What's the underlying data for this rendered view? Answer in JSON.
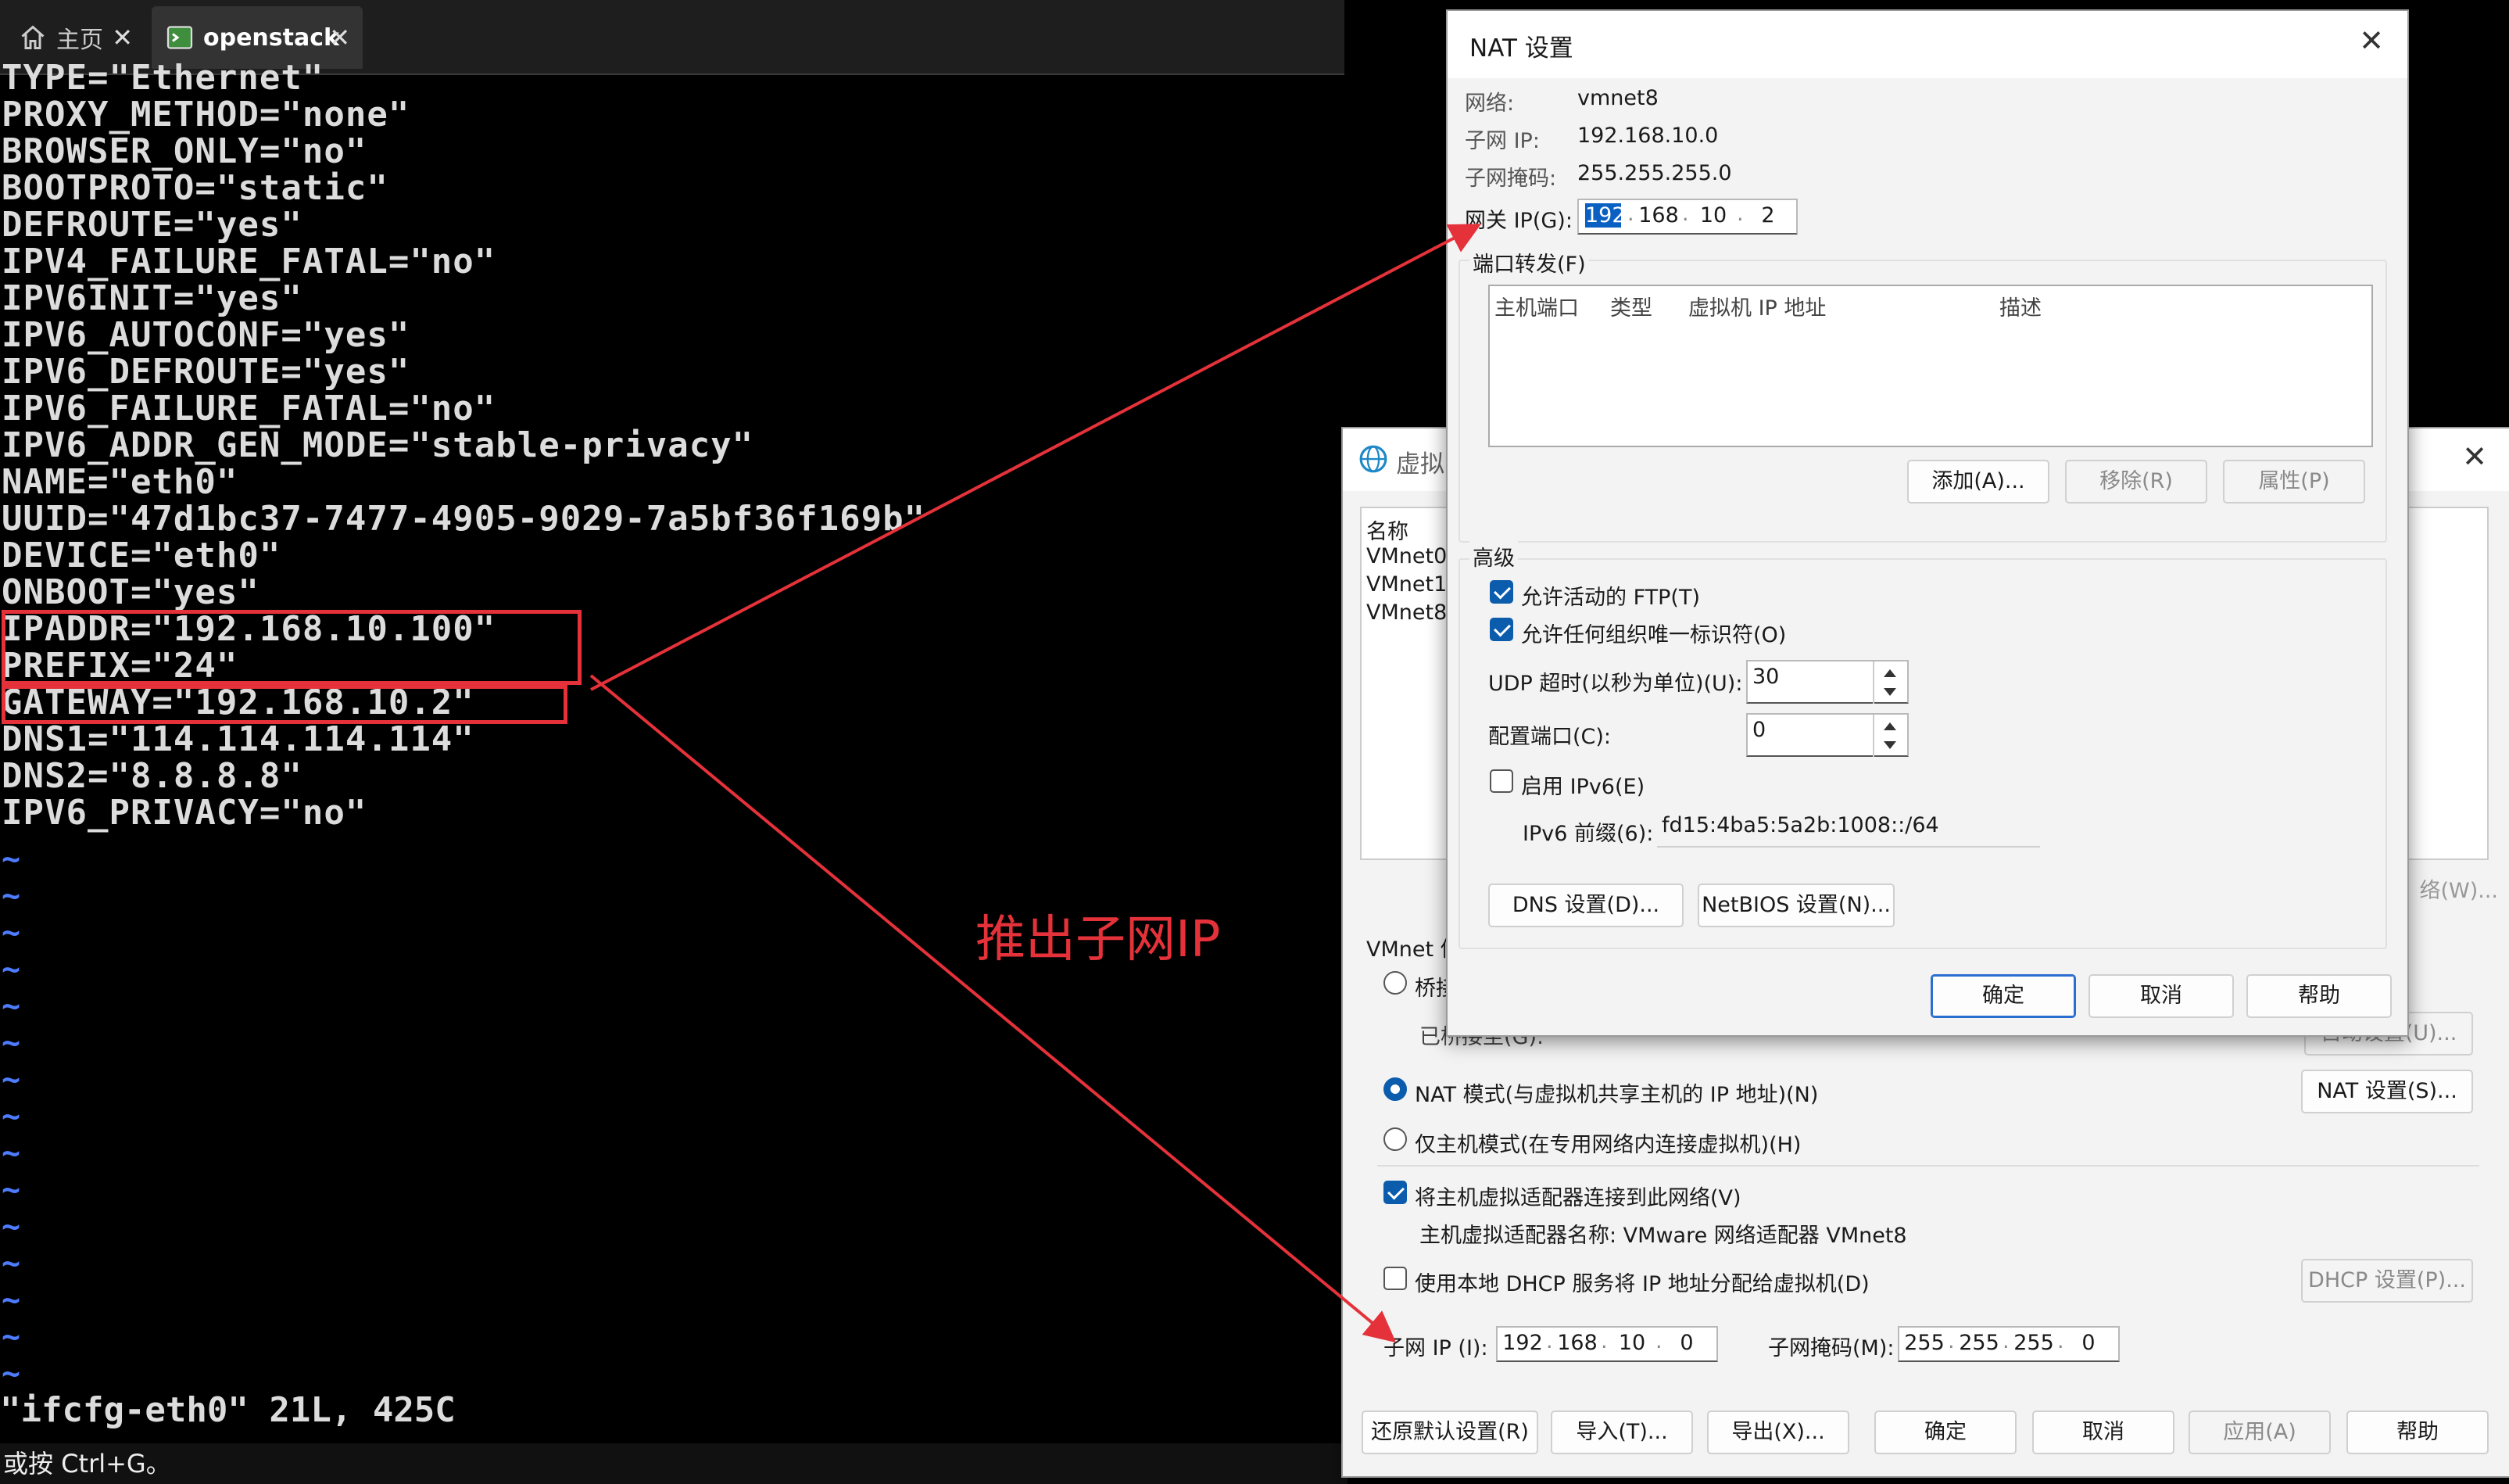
{
  "tabs": [
    {
      "label": "主页",
      "icon": "home-icon"
    },
    {
      "label": "openstack",
      "icon": "terminal-icon"
    }
  ],
  "terminal": {
    "lines": [
      "TYPE=\"Ethernet\"",
      "PROXY_METHOD=\"none\"",
      "BROWSER_ONLY=\"no\"",
      "BOOTPROTO=\"static\"",
      "DEFROUTE=\"yes\"",
      "IPV4_FAILURE_FATAL=\"no\"",
      "IPV6INIT=\"yes\"",
      "IPV6_AUTOCONF=\"yes\"",
      "IPV6_DEFROUTE=\"yes\"",
      "IPV6_FAILURE_FATAL=\"no\"",
      "IPV6_ADDR_GEN_MODE=\"stable-privacy\"",
      "NAME=\"eth0\"",
      "UUID=\"47d1bc37-7477-4905-9029-7a5bf36f169b\"",
      "DEVICE=\"eth0\"",
      "ONBOOT=\"yes\"",
      "IPADDR=\"192.168.10.100\"",
      "PREFIX=\"24\"",
      "GATEWAY=\"192.168.10.2\"",
      "DNS1=\"114.114.114.114\"",
      "DNS2=\"8.8.8.8\"",
      "IPV6_PRIVACY=\"no\""
    ],
    "tilde": "~",
    "status_line": "\"ifcfg-eth0\" 21L, 425C",
    "bottom_hint": "或按 Ctrl+G。"
  },
  "annotation": "推出子网IP",
  "vne": {
    "title": "虚拟",
    "list_header": "名称",
    "networks": [
      "VMnet0",
      "VMnet1",
      "VMnet8"
    ],
    "partial_right_btn": "络(W)...",
    "vmnet_info_label": "VMnet 信",
    "bridge_label": "桥接",
    "bridged_to_label": "已桥接至(G):",
    "auto_settings_btn": "自动设置(U)...",
    "nat_mode_label": "NAT 模式(与虚拟机共享主机的 IP 地址)(N)",
    "nat_settings_btn": "NAT 设置(S)...",
    "hostonly_label": "仅主机模式(在专用网络内连接虚拟机)(H)",
    "connect_adapter_label": "将主机虚拟适配器连接到此网络(V)",
    "adapter_name_label": "主机虚拟适配器名称: VMware 网络适配器 VMnet8",
    "dhcp_label": "使用本地 DHCP 服务将 IP 地址分配给虚拟机(D)",
    "dhcp_settings_btn": "DHCP 设置(P)...",
    "subnet_ip_label": "子网 IP (I):",
    "subnet_ip": [
      "192",
      "168",
      "10",
      "0"
    ],
    "subnet_mask_label": "子网掩码(M):",
    "subnet_mask": [
      "255",
      "255",
      "255",
      "0"
    ],
    "buttons": {
      "restore": "还原默认设置(R)",
      "import": "导入(T)...",
      "export": "导出(X)...",
      "ok": "确定",
      "cancel": "取消",
      "apply": "应用(A)",
      "help": "帮助"
    }
  },
  "nat": {
    "title": "NAT 设置",
    "network_label": "网络:",
    "network_value": "vmnet8",
    "subnet_ip_label": "子网 IP:",
    "subnet_ip_value": "192.168.10.0",
    "subnet_mask_label": "子网掩码:",
    "subnet_mask_value": "255.255.255.0",
    "gateway_label": "网关 IP(G):",
    "gateway": [
      "192",
      "168",
      "10",
      "2"
    ],
    "port_forward_label": "端口转发(F)",
    "pf_columns": [
      "主机端口",
      "类型",
      "虚拟机 IP 地址",
      "描述"
    ],
    "add_btn": "添加(A)...",
    "remove_btn": "移除(R)",
    "props_btn": "属性(P)",
    "advanced_label": "高级",
    "allow_ftp_label": "允许活动的 FTP(T)",
    "allow_oui_label": "允许任何组织唯一标识符(O)",
    "udp_timeout_label": "UDP 超时(以秒为单位)(U):",
    "udp_timeout_value": "30",
    "config_port_label": "配置端口(C):",
    "config_port_value": "0",
    "enable_ipv6_label": "启用 IPv6(E)",
    "ipv6_prefix_label": "IPv6 前缀(6):",
    "ipv6_prefix_value": "fd15:4ba5:5a2b:1008::/64",
    "dns_btn": "DNS 设置(D)...",
    "netbios_btn": "NetBIOS 设置(N)...",
    "ok_btn": "确定",
    "cancel_btn": "取消",
    "help_btn": "帮助"
  },
  "colors": {
    "annotation_red": "#e5323a",
    "accent_blue": "#0b5cad",
    "terminal_bg": "#000000"
  }
}
